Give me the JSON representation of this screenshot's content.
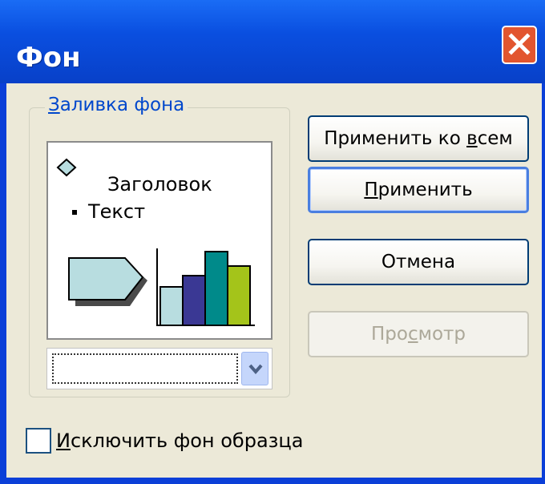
{
  "window": {
    "title": "Фон"
  },
  "fill_group": {
    "legend_accel": "З",
    "legend_rest": "аливка фона",
    "preview": {
      "heading": "Заголовок",
      "body_text": "Текст"
    },
    "fill_select": {
      "value": ""
    }
  },
  "buttons": {
    "apply_all": {
      "pre": "Применить ко ",
      "accel": "в",
      "post": "сем"
    },
    "apply": {
      "accel": "П",
      "post": "рименить"
    },
    "cancel": {
      "label": "Отмена"
    },
    "preview": {
      "pre": "Про",
      "accel": "с",
      "post": "мотр",
      "enabled": false
    }
  },
  "omit_master_background": {
    "pre": "",
    "accel": "И",
    "post": "сключить фон образца",
    "checked": false
  },
  "colors": {
    "titlebar": "#0a4fe0",
    "dialog_bg": "#ece9d8",
    "close_button": "#e2552f",
    "bar_1": "#b8dde0",
    "bar_2": "#3a3894",
    "bar_3": "#008a8a",
    "bar_4": "#a4c41a",
    "arrow_shape": "#b8dde0"
  }
}
